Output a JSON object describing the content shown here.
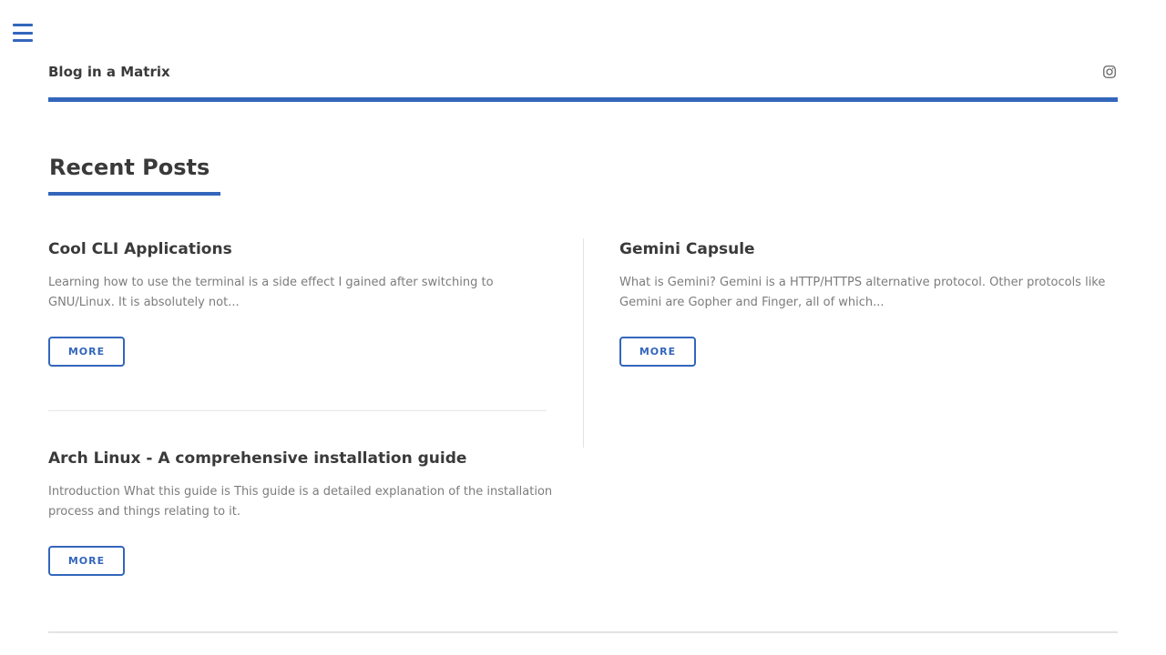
{
  "header": {
    "site_title": "Blog in a Matrix",
    "menu_icon": "hamburger-menu-icon",
    "social_icon": "instagram-icon",
    "accent_color": "#3366bb"
  },
  "main": {
    "section_title": "Recent Posts",
    "posts": [
      {
        "title": "Cool CLI Applications",
        "excerpt": "Learning how to use the terminal is a side effect I gained after switching to GNU/Linux. It is absolutely not...",
        "more_label": "MORE"
      },
      {
        "title": "Gemini Capsule",
        "excerpt": "What is Gemini? Gemini is a HTTP/HTTPS alternative protocol. Other protocols like Gemini are Gopher and Finger, all of which...",
        "more_label": "MORE"
      },
      {
        "title": "Arch Linux - A comprehensive installation guide",
        "excerpt": "Introduction What this guide is This guide is a detailed explanation of the installation process and things relating to it.",
        "more_label": "MORE"
      }
    ]
  }
}
